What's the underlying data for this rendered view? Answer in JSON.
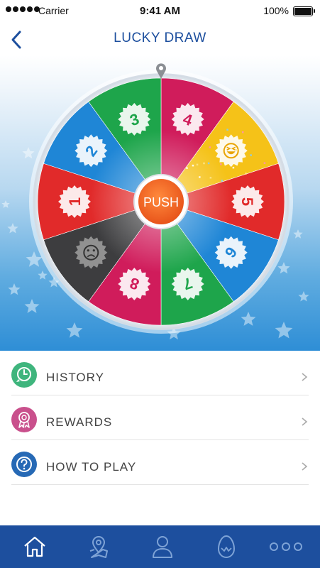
{
  "status_bar": {
    "carrier": "Carrier",
    "time": "9:41 AM",
    "battery": "100%"
  },
  "header": {
    "title": "LUCKY DRAW",
    "back_icon": "chevron-left-icon"
  },
  "wheel": {
    "center_label": "PUSH",
    "segments": [
      {
        "label": "4",
        "color": "#d01c5b"
      },
      {
        "label": "",
        "icon": "laughing-face-icon",
        "color": "#f5c218"
      },
      {
        "label": "5",
        "color": "#e12a2a"
      },
      {
        "label": "6",
        "color": "#1f86d6"
      },
      {
        "label": "7",
        "color": "#1ea54b"
      },
      {
        "label": "8",
        "color": "#d01c5b"
      },
      {
        "label": "",
        "icon": "sad-face-icon",
        "color": "#3d3d3f"
      },
      {
        "label": "1",
        "color": "#e12a2a"
      },
      {
        "label": "2",
        "color": "#1f86d6"
      },
      {
        "label": "3",
        "color": "#1ea54b"
      }
    ]
  },
  "menu": {
    "items": [
      {
        "label": "HISTORY",
        "icon": "clock-icon",
        "color": "#3fb57d"
      },
      {
        "label": "REWARDS",
        "icon": "ribbon-award-icon",
        "color": "#c9508c"
      },
      {
        "label": "HOW TO PLAY",
        "icon": "question-icon",
        "color": "#2669b5"
      }
    ]
  },
  "tab_bar": {
    "tabs": [
      {
        "icon": "home-icon",
        "active": true
      },
      {
        "icon": "map-pin-icon"
      },
      {
        "icon": "user-icon"
      },
      {
        "icon": "egg-icon"
      },
      {
        "icon": "more-icon"
      }
    ]
  },
  "colors": {
    "brand_blue": "#1d4f9e",
    "push_orange": "#f26a22"
  }
}
